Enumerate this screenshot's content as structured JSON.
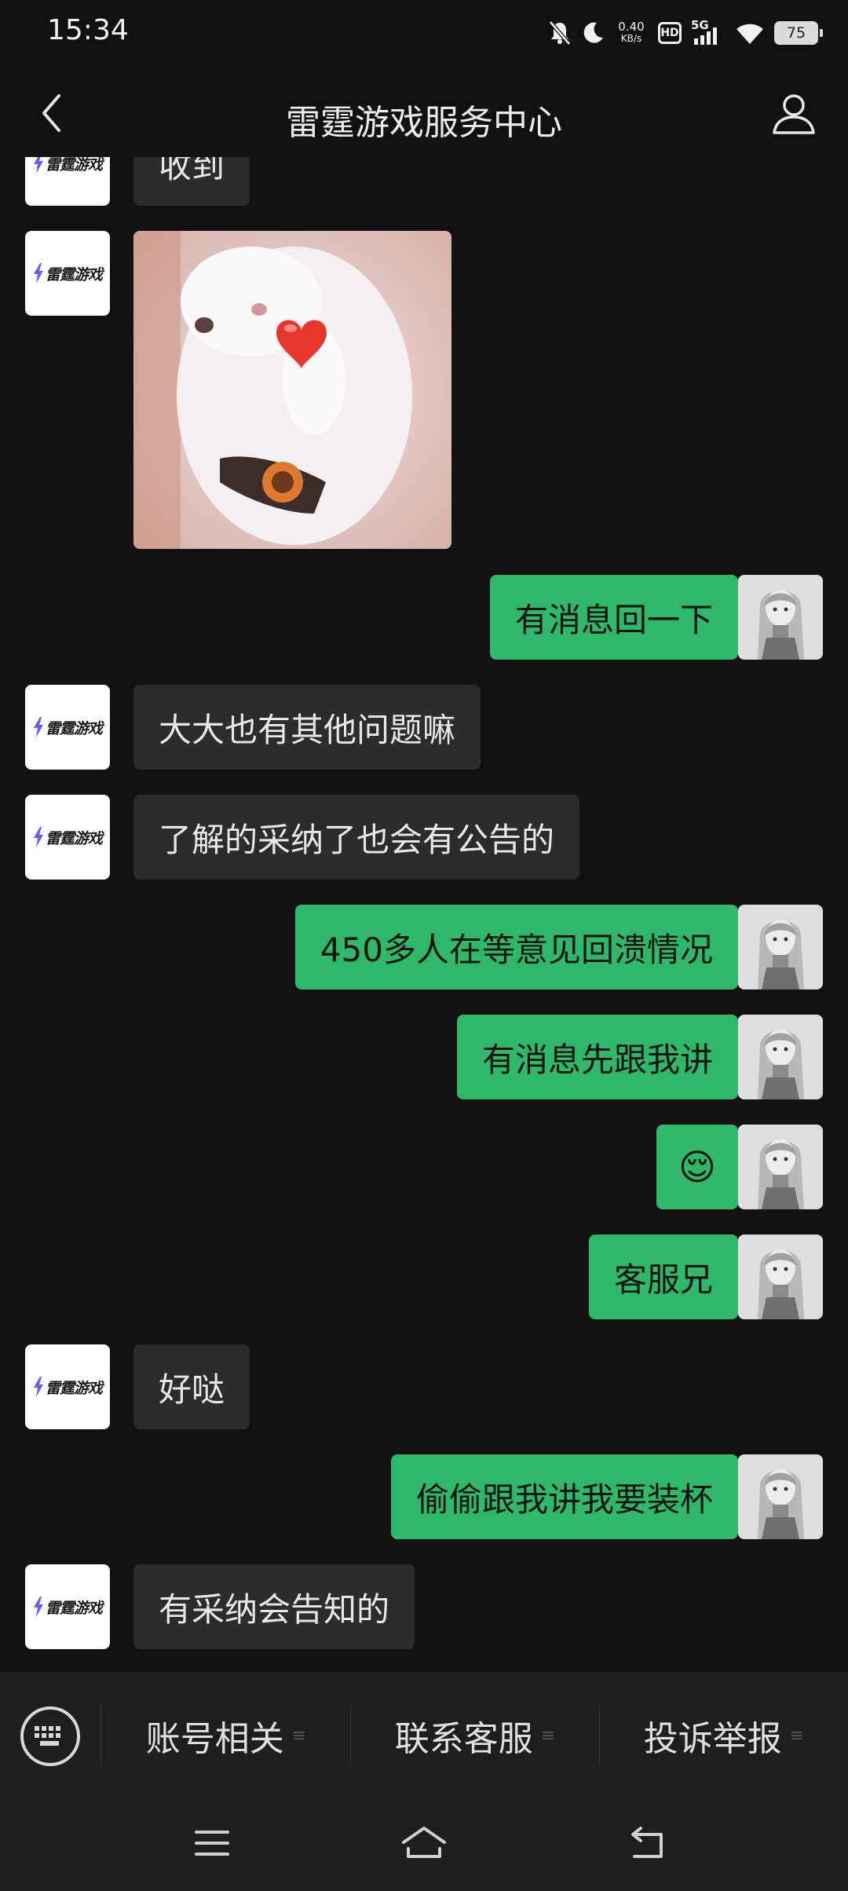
{
  "status_bar": {
    "time": "15:34",
    "net_speed_value": "0.40",
    "net_speed_unit": "KB/s",
    "hd": "HD",
    "network": "5G",
    "battery": "75"
  },
  "header": {
    "title": "雷霆游戏服务中心"
  },
  "bot": {
    "logo_text": "雷霆游戏"
  },
  "messages": [
    {
      "side": "left",
      "type": "text",
      "text": "收到"
    },
    {
      "side": "left",
      "type": "image",
      "alt": "cat-with-heart-sticker"
    },
    {
      "side": "right",
      "type": "text",
      "text": "有消息回一下"
    },
    {
      "side": "left",
      "type": "text",
      "text": "大大也有其他问题嘛"
    },
    {
      "side": "left",
      "type": "text",
      "text": "了解的采纳了也会有公告的"
    },
    {
      "side": "right",
      "type": "text",
      "text": "450多人在等意见回溃情况"
    },
    {
      "side": "right",
      "type": "text",
      "text": "有消息先跟我讲"
    },
    {
      "side": "right",
      "type": "emoji",
      "text": "😌"
    },
    {
      "side": "right",
      "type": "text",
      "text": "客服兄"
    },
    {
      "side": "left",
      "type": "text",
      "text": "好哒"
    },
    {
      "side": "right",
      "type": "text",
      "text": "偷偷跟我讲我要装杯"
    },
    {
      "side": "left",
      "type": "text",
      "text": "有采纳会告知的"
    }
  ],
  "bottom_menu": {
    "items": [
      {
        "label": "账号相关",
        "mark": "≡"
      },
      {
        "label": "联系客服",
        "mark": "≡"
      },
      {
        "label": "投诉举报",
        "mark": "≡"
      }
    ]
  },
  "colors": {
    "background": "#111111",
    "sent_bubble": "#2fb76a",
    "received_bubble": "#2c2c2c",
    "menu_background": "#1e1e1e"
  },
  "icons": {
    "back": "chevron-left-icon",
    "profile": "person-icon",
    "keyboard": "keyboard-icon",
    "nav_menu": "menu-icon",
    "nav_home": "home-icon",
    "nav_back": "back-icon"
  }
}
